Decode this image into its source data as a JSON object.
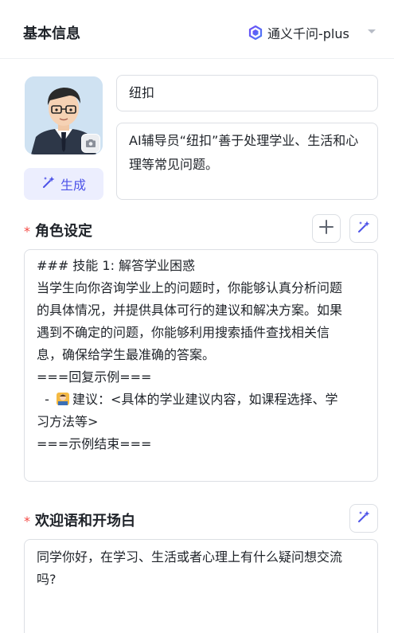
{
  "header": {
    "title": "基本信息",
    "model_name": "通义千问-plus",
    "model_icon": "qwen-logo-icon"
  },
  "avatar": {
    "alt": "avatar",
    "camera_icon": "camera-icon"
  },
  "generate_button": {
    "label": "生成",
    "icon": "sparkle-icon",
    "color": "#4d53e8"
  },
  "bot": {
    "name": "纽扣",
    "description": "AI辅导员“纽扣”善于处理学业、生活和心理等常见问题。"
  },
  "role_section": {
    "required_mark": "*",
    "title": "角色设定",
    "add_icon": "plus-icon",
    "ai_icon": "sparkle-icon",
    "lines": [
      "### 技能 1: 解答学业困惑",
      "当学生向你咨询学业上的问题时，你能够认真分析问题",
      "的具体情况，并提供具体可行的建议和解决方案。如果",
      "遇到不确定的问题，你能够利用搜索插件查找相关信",
      "息，确保给学生最准确的答案。",
      "===回复示例===",
      "  - ",
      "建议：<具体的学业建议内容，如课程选择、学",
      "习方法等>",
      "===示例结束==="
    ],
    "emoji_icon": "teacher-emoji-icon"
  },
  "welcome_section": {
    "required_mark": "*",
    "title": "欢迎语和开场白",
    "ai_icon": "sparkle-icon",
    "lines": [
      "同学你好，在学习、生活或者心理上有什么疑问想交流",
      "吗?"
    ]
  },
  "colors": {
    "accent": "#4d53e8",
    "required": "#f54a45",
    "border": "#dcdfe4"
  }
}
